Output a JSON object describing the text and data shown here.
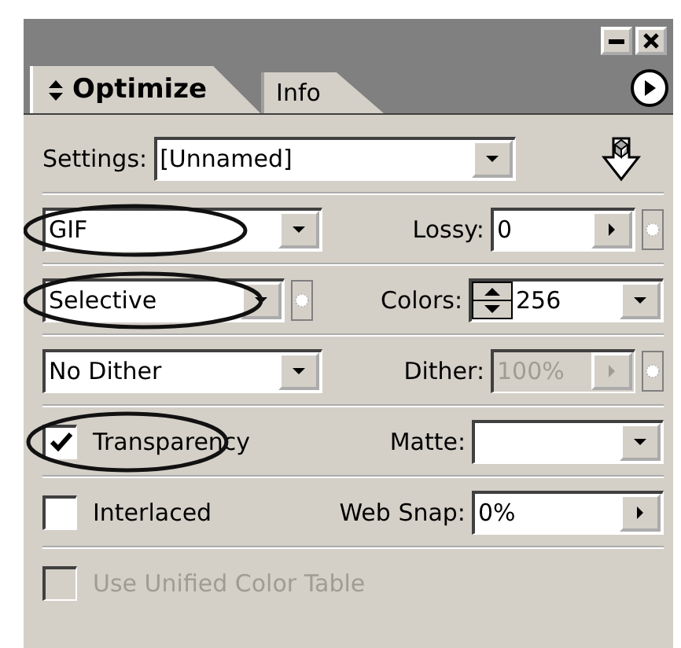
{
  "tabs": [
    {
      "label": "Optimize",
      "selected": true
    },
    {
      "label": "Info",
      "selected": false
    }
  ],
  "settings": {
    "label": "Settings:",
    "value": "[Unnamed]"
  },
  "format": {
    "value": "GIF",
    "circled": true
  },
  "lossy": {
    "label": "Lossy:",
    "value": "0"
  },
  "reduction": {
    "value": "Selective",
    "circled": true
  },
  "colors": {
    "label": "Colors:",
    "value": "256"
  },
  "dither_algorithm": {
    "value": "No Dither"
  },
  "dither": {
    "label": "Dither:",
    "value": "100%",
    "disabled": true
  },
  "transparency": {
    "label": "Transparency",
    "checked": true,
    "circled": true
  },
  "matte": {
    "label": "Matte:"
  },
  "interlaced": {
    "label": "Interlaced",
    "checked": false
  },
  "web_snap": {
    "label": "Web Snap:",
    "value": "0%"
  },
  "unified_color_table": {
    "label": "Use Unified Color Table",
    "checked": false,
    "disabled": true
  }
}
